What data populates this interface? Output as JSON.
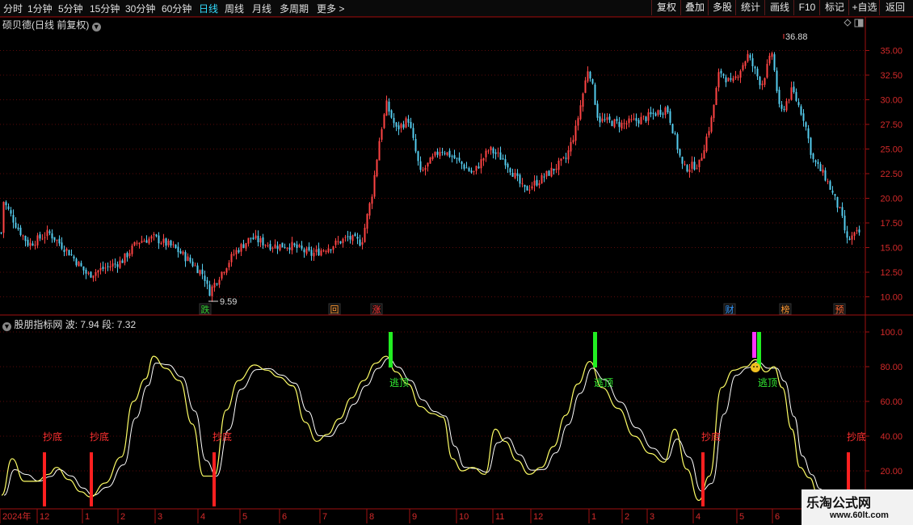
{
  "toolbar": {
    "periods": [
      "分时",
      "1分钟",
      "5分钟",
      "15分钟",
      "30分钟",
      "60分钟",
      "日线",
      "周线",
      "月线",
      "多周期",
      "更多 >"
    ],
    "active_period": "日线",
    "buttons": [
      "复权",
      "叠加",
      "多股",
      "统计",
      "画线",
      "F10",
      "标记",
      "+自选",
      "返回"
    ]
  },
  "main_chart": {
    "title": "硕贝德(日线 前复权)",
    "y_ticks": [
      "35.00",
      "32.50",
      "30.00",
      "27.50",
      "25.00",
      "22.50",
      "20.00",
      "17.50",
      "15.00",
      "12.50",
      "10.00"
    ],
    "high_label": "36.88",
    "low_label": "9.59",
    "events": [
      {
        "label": "跌",
        "color": "#33cc33"
      },
      {
        "label": "回",
        "color": "#ff9933"
      },
      {
        "label": "涨",
        "color": "#ff3333"
      },
      {
        "label": "财",
        "color": "#3399ff"
      },
      {
        "label": "榜",
        "color": "#ff9933"
      },
      {
        "label": "预",
        "color": "#ff6633"
      }
    ]
  },
  "indicator": {
    "name": "股朋指标网",
    "wave_label": "波:",
    "wave_value": "7.94",
    "segment_label": "段:",
    "segment_value": "7.32",
    "y_ticks": [
      "100.0",
      "80.00",
      "60.00",
      "40.00",
      "20.00"
    ],
    "buy_label": "抄底",
    "sell_label": "逃顶"
  },
  "x_axis": {
    "labels": [
      "2024年",
      "12",
      "1",
      "2",
      "3",
      "4",
      "5",
      "6",
      "7",
      "8",
      "9",
      "10",
      "11",
      "12",
      "1",
      "2",
      "3",
      "4",
      "5",
      "6"
    ]
  },
  "watermark": {
    "title": "乐淘公式网",
    "url": "www.60lt.com"
  },
  "colors": {
    "up": "#ff4444",
    "down": "#55ccee",
    "axis": "#b01010",
    "wave": "#ffff66",
    "segment": "#ffffff",
    "buy_signal": "#ff2020",
    "sell_signal": "#22ee22",
    "top_marker": "#ff33ff"
  }
}
